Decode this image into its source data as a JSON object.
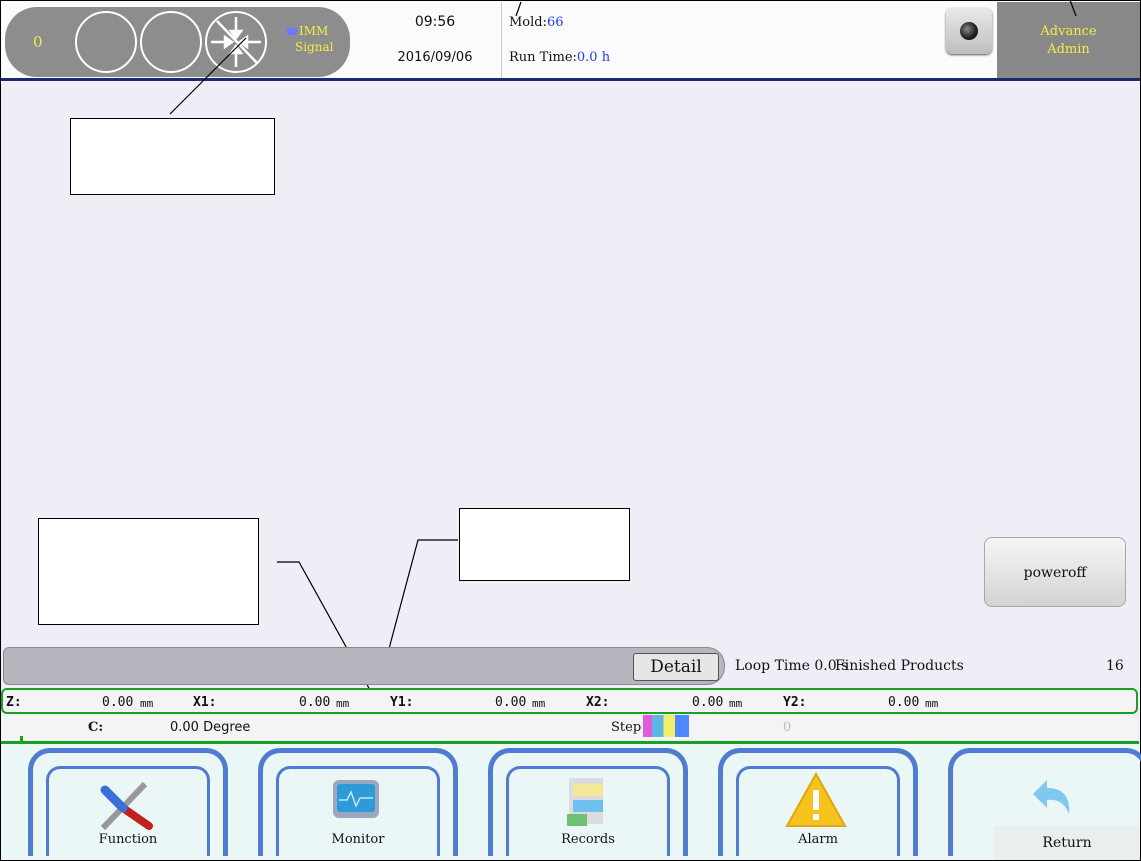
{
  "header": {
    "counter": "0",
    "imm_line1": "IMM",
    "imm_line2": "Signal",
    "time": "09:56",
    "date": "2016/09/06",
    "mold_label": "Mold:",
    "mold_value": "66",
    "runtime_label": "Run Time:",
    "runtime_value": "0.0 h",
    "user_line1": "Advance",
    "user_line2": "Admin"
  },
  "main": {
    "poweroff_label": "poweroff"
  },
  "status": {
    "detail_label": "Detail",
    "loop_text": "Loop Time   0.0 s",
    "finished_text": "Finished Products",
    "finished_count": "16"
  },
  "axes": {
    "z_label": "Z:",
    "z_value": "0.00",
    "x1_label": "X1:",
    "x1_value": "0.00",
    "y1_label": "Y1:",
    "y1_value": "0.00",
    "x2_label": "X2:",
    "x2_value": "0.00",
    "y2_label": "Y2:",
    "y2_value": "0.00",
    "unit": "mm",
    "c_label": "C:",
    "c_value": "0.00 Degree",
    "step_label": "Step",
    "step_value": "0"
  },
  "nav": {
    "items": [
      {
        "label": "Function",
        "icon": "tools-icon"
      },
      {
        "label": "Monitor",
        "icon": "monitor-icon"
      },
      {
        "label": "Records",
        "icon": "records-icon"
      },
      {
        "label": "Alarm",
        "icon": "warning-icon"
      },
      {
        "label": "Return",
        "icon": "return-arrow-icon"
      }
    ]
  },
  "colors": {
    "accent_yellow": "#f4ee44",
    "header_line": "#1d2b6e",
    "value_blue": "#1f3cff",
    "panel_green": "#19a020",
    "nav_blue": "#4f7bd0"
  }
}
